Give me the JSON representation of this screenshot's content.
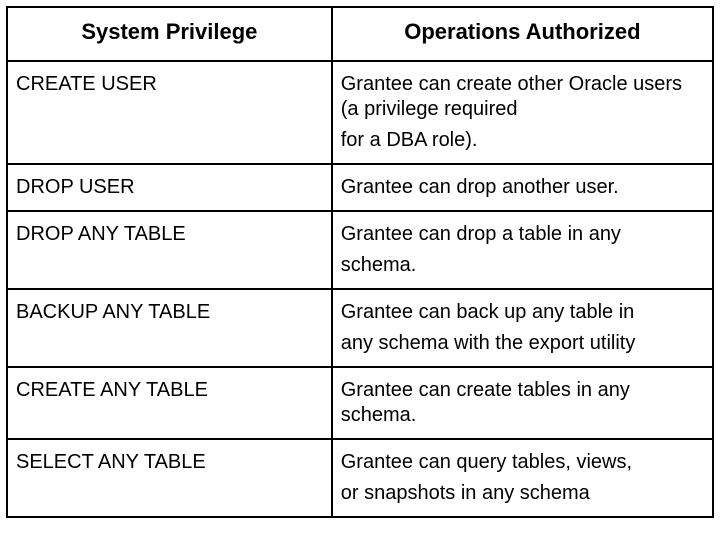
{
  "headers": {
    "privilege": "System Privilege",
    "operations": "Operations Authorized"
  },
  "rows": [
    {
      "privilege": "CREATE USER",
      "ops": [
        "Grantee can create other Oracle users (a privilege required",
        "for a DBA role)."
      ]
    },
    {
      "privilege": "DROP USER",
      "ops": [
        "Grantee can drop another user."
      ]
    },
    {
      "privilege": "DROP ANY TABLE",
      "ops": [
        "Grantee can drop a table in any",
        "schema."
      ]
    },
    {
      "privilege": "BACKUP ANY TABLE",
      "ops": [
        "Grantee can back up any table in",
        "any schema with the export utility"
      ]
    },
    {
      "privilege": "CREATE ANY TABLE",
      "ops": [
        "Grantee can create tables in any schema."
      ]
    },
    {
      "privilege": "SELECT ANY TABLE",
      "ops": [
        "Grantee can query tables, views,",
        "or snapshots in any schema"
      ]
    }
  ]
}
